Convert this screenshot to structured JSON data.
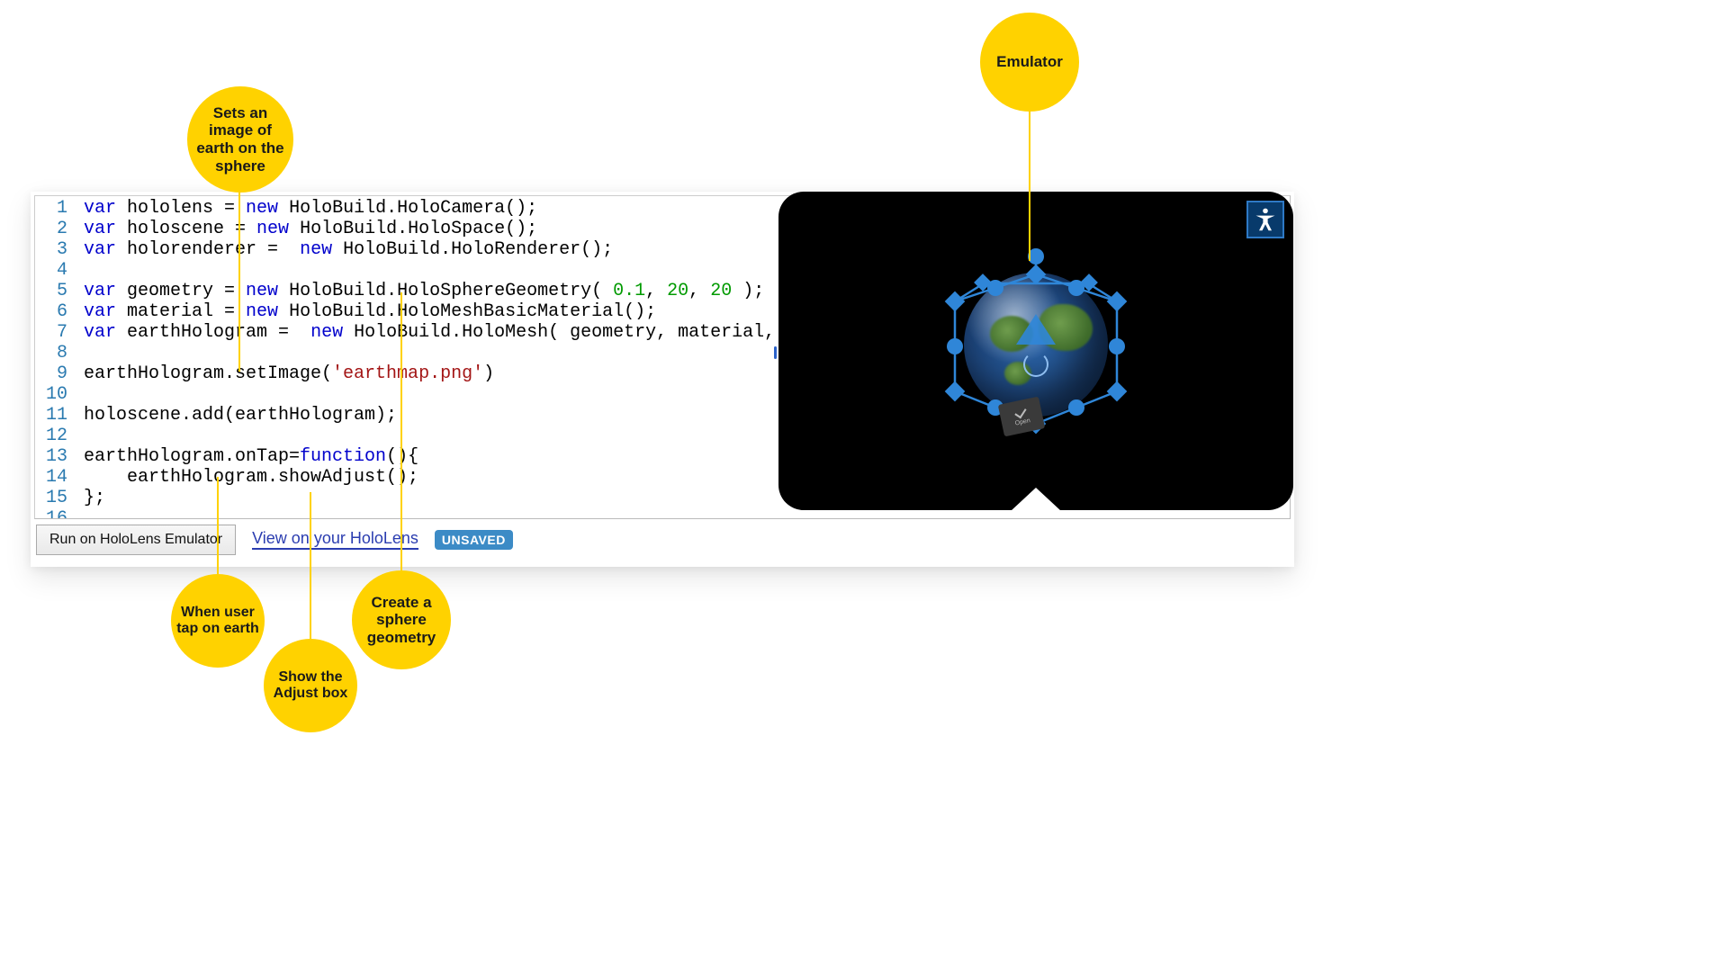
{
  "callouts": {
    "set_image": "Sets an image of earth on the sphere",
    "emulator": "Emulator",
    "when_tap": "When user tap on earth",
    "show_adjust": "Show the Adjust box",
    "create_sphere": "Create a sphere geometry"
  },
  "code": {
    "lines": [
      "var hololens = new HoloBuild.HoloCamera();",
      "var holoscene = new HoloBuild.HoloSpace();",
      "var holorenderer =  new HoloBuild.HoloRenderer();",
      "",
      "var geometry = new HoloBuild.HoloSphereGeometry( 0.1, 20, 20 );",
      "var material = new HoloBuild.HoloMeshBasicMaterial();",
      "var earthHologram =  new HoloBuild.HoloMesh( geometry, material, true );",
      "",
      "earthHologram.setImage('earthmap.png')",
      "",
      "holoscene.add(earthHologram);",
      "",
      "earthHologram.onTap=function(){",
      "    earthHologram.showAdjust();",
      "};",
      ""
    ]
  },
  "actions": {
    "run_button": "Run on HoloLens Emulator",
    "view_link": "View on your HoloLens",
    "unsaved_badge": "UNSAVED"
  },
  "emulator": {
    "accessibility_icon": "accessibility-icon",
    "adjust_label": "Open"
  }
}
